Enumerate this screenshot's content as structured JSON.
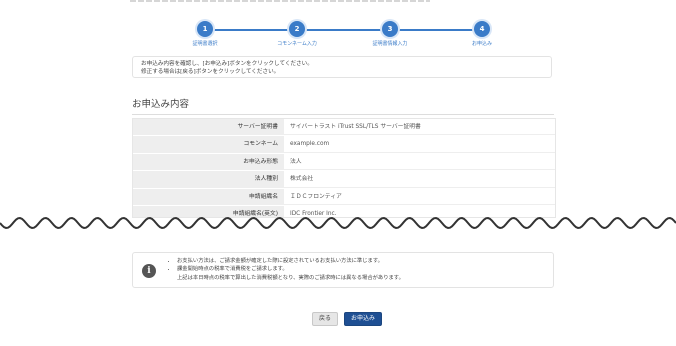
{
  "steps": [
    {
      "num": "1",
      "label": "証明書選択"
    },
    {
      "num": "2",
      "label": "コモンネーム入力"
    },
    {
      "num": "3",
      "label": "証明書情報入力"
    },
    {
      "num": "4",
      "label": "お申込み"
    }
  ],
  "notice": {
    "line1": "お申込み内容を確認し、[お申込み]ボタンをクリックしてください。",
    "line2": "修正する場合は[戻る]ボタンをクリックしてください。"
  },
  "section_title": "お申込み内容",
  "details": [
    {
      "key": "サーバー証明書",
      "value": "サイバートラスト iTrust SSL/TLS サーバー証明書"
    },
    {
      "key": "コモンネーム",
      "value": "example.com"
    },
    {
      "key": "お申込み形態",
      "value": "法人"
    },
    {
      "key": "法人種別",
      "value": "株式会社"
    },
    {
      "key": "申請組織名",
      "value": "ＩＤＣフロンティア"
    },
    {
      "key": "申請組織名(英文)",
      "value": "IDC Frontier Inc."
    }
  ],
  "info": {
    "icon": "info-icon",
    "bullet1": "お支払い方法は、ご請求金額が確定した際に設定されているお支払い方法に準じます。",
    "bullet2": "課金開始時点の税率で消費税をご請求します。",
    "bullet3": "上記は本日時点の税率で算出した消費税額となり、実際のご請求時には異なる場合があります。"
  },
  "buttons": {
    "back": "戻る",
    "submit": "お申込み"
  },
  "colors": {
    "accent": "#3a7bc8",
    "primary_button": "#1e4f93"
  }
}
